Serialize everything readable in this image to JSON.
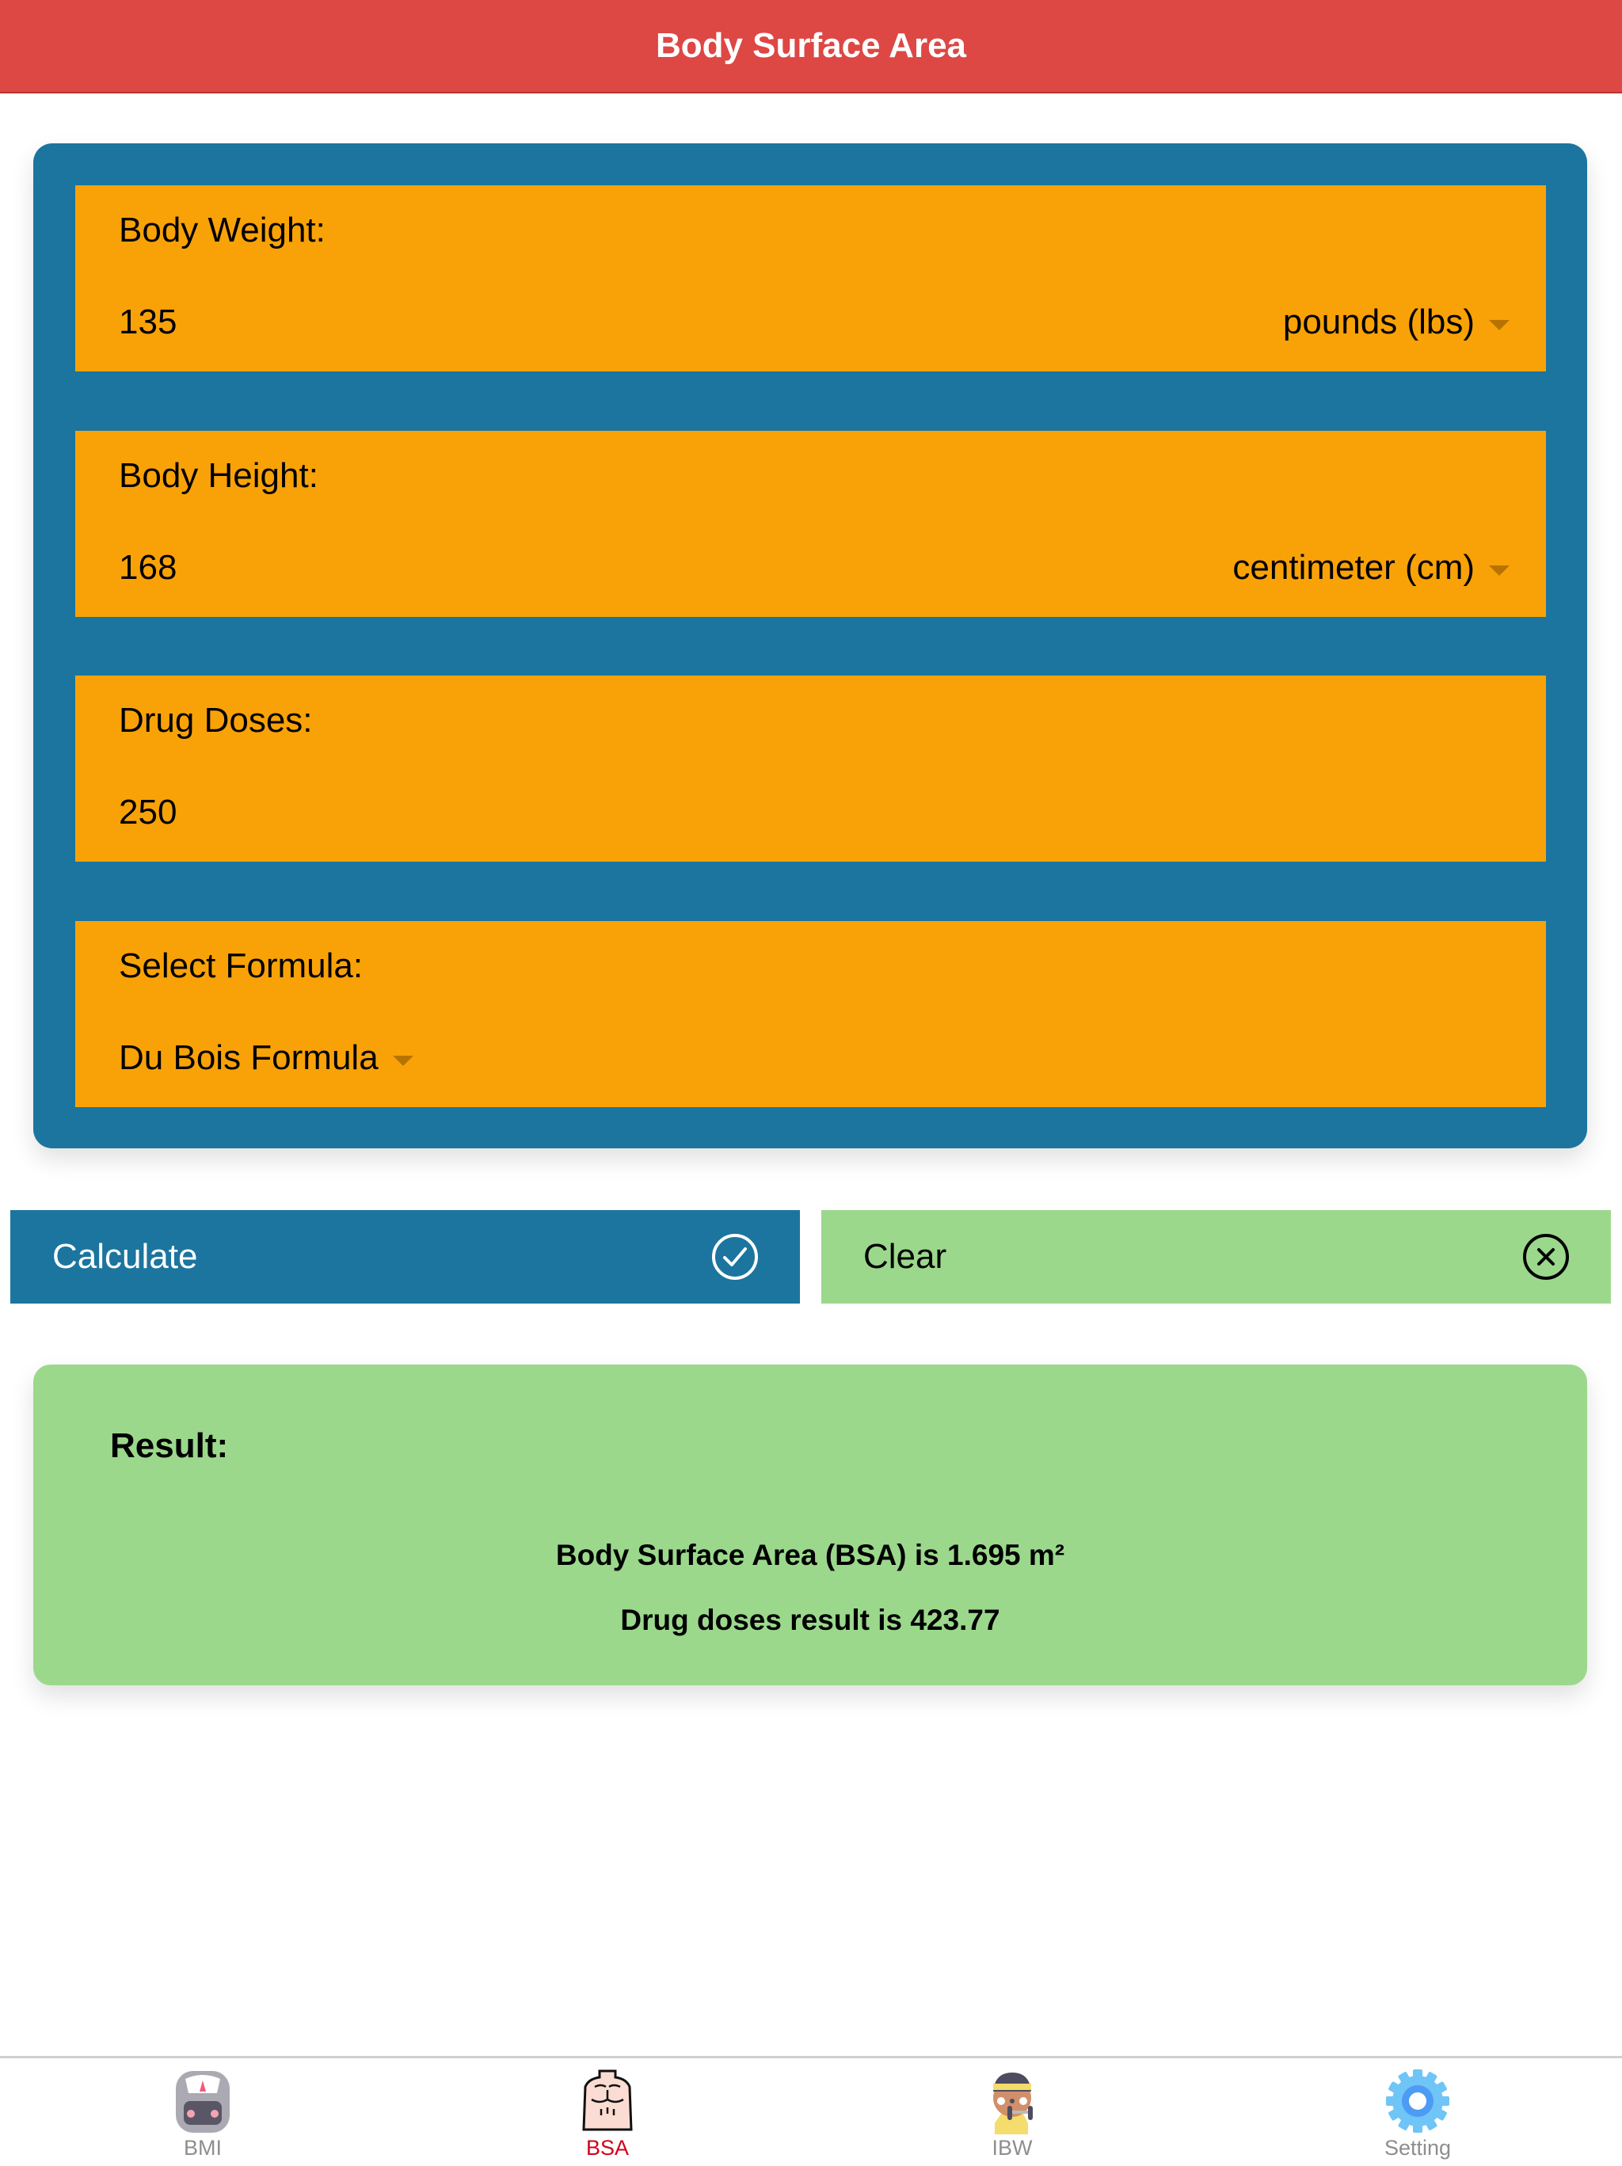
{
  "header": {
    "title": "Body Surface Area"
  },
  "form": {
    "weight": {
      "label": "Body Weight:",
      "value": "135",
      "unit": "pounds (lbs)"
    },
    "height": {
      "label": "Body Height:",
      "value": "168",
      "unit": "centimeter (cm)"
    },
    "doses": {
      "label": "Drug Doses:",
      "value": "250"
    },
    "formula": {
      "label": "Select Formula:",
      "value": "Du Bois Formula"
    }
  },
  "buttons": {
    "calculate": {
      "label": "Calculate",
      "icon": "check-circle-icon"
    },
    "clear": {
      "label": "Clear",
      "icon": "x-circle-icon"
    }
  },
  "result": {
    "title": "Result:",
    "bsa_line": "Body Surface Area (BSA) is 1.695 m²",
    "dose_line": "Drug doses result is 423.77"
  },
  "tabbar": {
    "items": [
      {
        "label": "BMI",
        "icon": "scale-icon",
        "active": false
      },
      {
        "label": "BSA",
        "icon": "torso-icon",
        "active": true
      },
      {
        "label": "IBW",
        "icon": "weightlifter-icon",
        "active": false
      },
      {
        "label": "Setting",
        "icon": "gear-icon",
        "active": false
      }
    ]
  },
  "colors": {
    "header": "#DD4744",
    "card": "#1B759F",
    "field": "#F9A207",
    "clear": "#9BD88C",
    "active_tab": "#D0021B"
  }
}
